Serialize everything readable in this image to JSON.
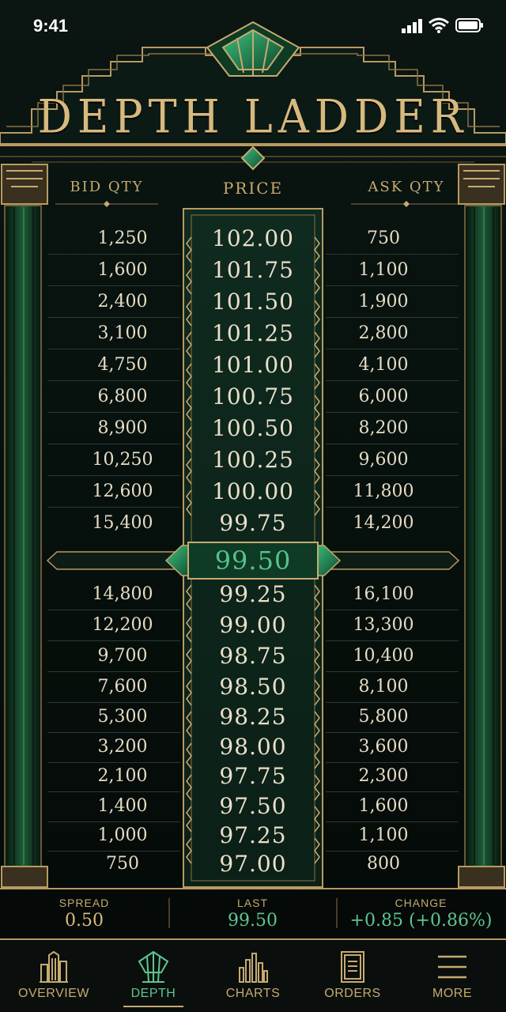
{
  "status": {
    "time": "9:41"
  },
  "header": {
    "title": "DEPTH LADDER"
  },
  "columns": {
    "bid": "BID QTY",
    "price": "PRICE",
    "ask": "ASK QTY"
  },
  "ladder": {
    "asks": [
      {
        "bid": "1,250",
        "price": "102.00",
        "ask": "750"
      },
      {
        "bid": "1,600",
        "price": "101.75",
        "ask": "1,100"
      },
      {
        "bid": "2,400",
        "price": "101.50",
        "ask": "1,900"
      },
      {
        "bid": "3,100",
        "price": "101.25",
        "ask": "2,800"
      },
      {
        "bid": "4,750",
        "price": "101.00",
        "ask": "4,100"
      },
      {
        "bid": "6,800",
        "price": "100.75",
        "ask": "6,000"
      },
      {
        "bid": "8,900",
        "price": "100.50",
        "ask": "8,200"
      },
      {
        "bid": "10,250",
        "price": "100.25",
        "ask": "9,600"
      },
      {
        "bid": "12,600",
        "price": "100.00",
        "ask": "11,800"
      },
      {
        "bid": "15,400",
        "price": "99.75",
        "ask": "14,200"
      }
    ],
    "mid_price": "99.50",
    "bids": [
      {
        "bid": "14,800",
        "price": "99.25",
        "ask": "16,100"
      },
      {
        "bid": "12,200",
        "price": "99.00",
        "ask": "13,300"
      },
      {
        "bid": "9,700",
        "price": "98.75",
        "ask": "10,400"
      },
      {
        "bid": "7,600",
        "price": "98.50",
        "ask": "8,100"
      },
      {
        "bid": "5,300",
        "price": "98.25",
        "ask": "5,800"
      },
      {
        "bid": "3,200",
        "price": "98.00",
        "ask": "3,600"
      },
      {
        "bid": "2,100",
        "price": "97.75",
        "ask": "2,300"
      },
      {
        "bid": "1,400",
        "price": "97.50",
        "ask": "1,600"
      },
      {
        "bid": "1,000",
        "price": "97.25",
        "ask": "1,100"
      },
      {
        "bid": "750",
        "price": "97.00",
        "ask": "800"
      }
    ]
  },
  "stats": {
    "spread_label": "SPREAD",
    "spread_value": "0.50",
    "last_label": "LAST",
    "last_value": "99.50",
    "change_label": "CHANGE",
    "change_value": "+0.85 (+0.86%)"
  },
  "nav": {
    "tabs": [
      {
        "label": "OVERVIEW",
        "icon": "buildings-icon"
      },
      {
        "label": "DEPTH",
        "icon": "depth-fan-icon"
      },
      {
        "label": "CHARTS",
        "icon": "bar-chart-icon"
      },
      {
        "label": "ORDERS",
        "icon": "document-icon"
      },
      {
        "label": "MORE",
        "icon": "menu-icon"
      }
    ],
    "active": "DEPTH"
  },
  "colors": {
    "gold": "#d8b97e",
    "green": "#5fc58f",
    "background": "#070c0a",
    "panel": "#0c2218"
  }
}
